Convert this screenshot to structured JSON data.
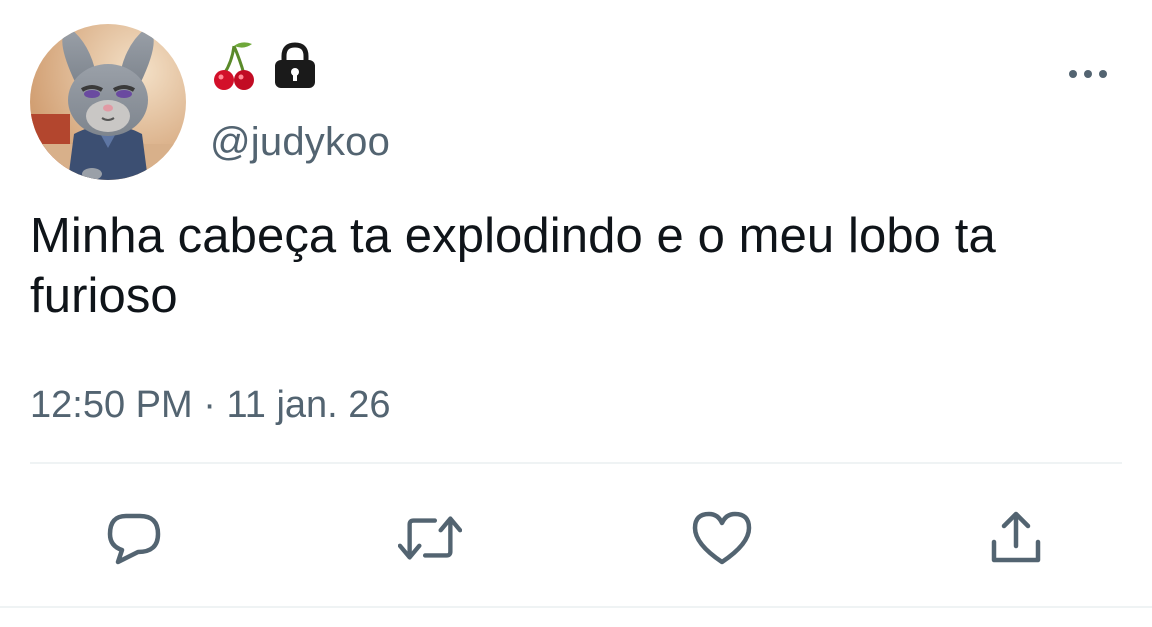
{
  "user": {
    "handle": "@judykoo",
    "emoji_icons": [
      "cherries-icon",
      "lock-icon"
    ]
  },
  "tweet": {
    "text": "Minha cabeça ta explodindo e o meu lobo ta furioso",
    "time": "12:50 PM",
    "separator": " · ",
    "date": "11 jan. 26"
  },
  "actions": {
    "reply_icon": "reply-icon",
    "retweet_icon": "retweet-icon",
    "like_icon": "heart-icon",
    "share_icon": "share-icon"
  },
  "colors": {
    "text": "#0f1419",
    "secondary": "#536471",
    "icon": "#536471",
    "divider": "#eff3f4"
  }
}
